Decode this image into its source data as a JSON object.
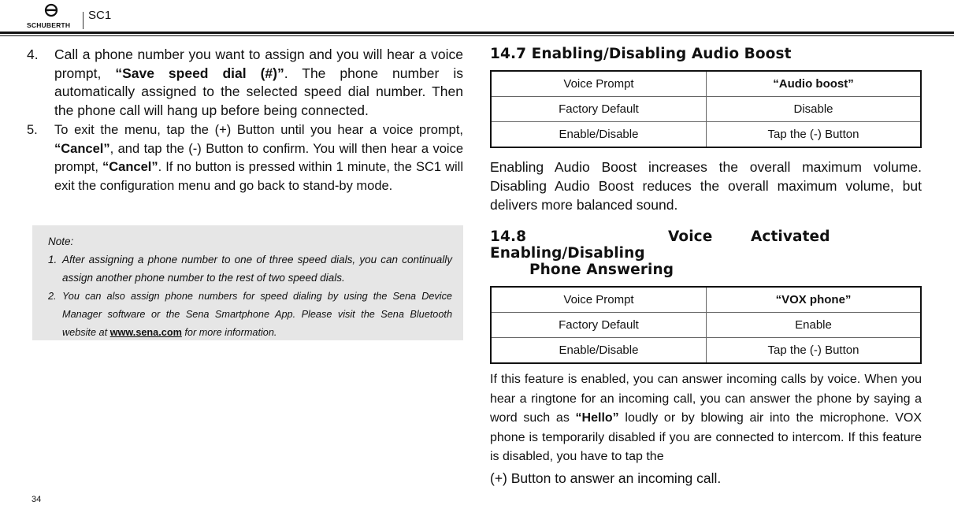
{
  "header": {
    "brand": "SCHUBERTH",
    "logo_icon": "schuberth-helmet-logo-icon",
    "product": "SC1"
  },
  "left": {
    "steps": [
      {
        "number": "4.",
        "text_1": "Call a phone number you want to assign and you will hear a voice prompt, ",
        "bold_1": "“Save speed dial (#)”",
        "text_2": ". The phone number is automatically assigned to the selected speed dial number. Then the phone call will hang up before being connected."
      },
      {
        "number": "5.",
        "text_1": "To exit the menu, tap the (+) Button until you hear a voice prompt, ",
        "bold_1": "“Cancel”",
        "text_2": ", and tap the (-) Button to confirm. You will then hear a voice prompt, ",
        "bold_2": "“Cancel”",
        "text_3": ". If no button is pressed within 1 minute, the SC1 will exit the configuration menu and go back to stand-by mode."
      }
    ],
    "note": {
      "title": "Note:",
      "items": [
        {
          "number": "1.",
          "text": "After assigning a phone number to one of three speed dials, you can continually assign another phone number to the rest of two speed dials."
        },
        {
          "number": "2.",
          "text_before": "You can also assign phone numbers for speed dialing by using the Sena Device Manager software or the Sena Smartphone App. Please visit the Sena Bluetooth website at ",
          "link": "www.sena.com",
          "text_after": " for more information."
        }
      ]
    },
    "page_number": "34"
  },
  "right": {
    "section_14_7": {
      "title": "14.7 Enabling/Disabling Audio Boost",
      "table": [
        {
          "label": "Voice Prompt",
          "value": "“Audio boost”"
        },
        {
          "label": "Factory Default",
          "value": "Disable"
        },
        {
          "label": "Enable/Disable",
          "value": "Tap the (-) Button"
        }
      ],
      "paragraph": "Enabling Audio Boost increases the overall maximum volume. Disabling Audio Boost reduces the overall maximum volume, but delivers more balanced sound."
    },
    "section_14_8": {
      "title_word_1": "14.8 Enabling/Disabling",
      "title_word_2": "Voice",
      "title_word_3": "Activated",
      "title_line_2": "Phone Answering",
      "table": [
        {
          "label": "Voice Prompt",
          "value": "“VOX phone”"
        },
        {
          "label": "Factory Default",
          "value": "Enable"
        },
        {
          "label": "Enable/Disable",
          "value": "Tap the (-) Button"
        }
      ],
      "paragraph_1": "If this feature is enabled, you can answer incoming calls by voice. When you hear a ringtone for an incoming call, you can answer the phone by saying a word such as ",
      "paragraph_bold": "“Hello”",
      "paragraph_2": " loudly or by blowing air into the microphone. VOX phone is temporarily disabled if you are connected to intercom. If this feature is disabled, you have to tap the",
      "paragraph_3": "(+) Button to answer an incoming call."
    }
  }
}
